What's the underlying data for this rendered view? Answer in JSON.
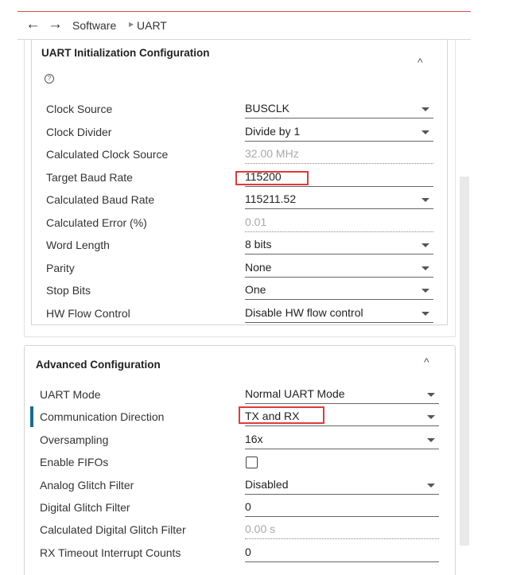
{
  "breadcrumb": {
    "back_icon": "arrow-left-icon",
    "forward_icon": "arrow-right-icon",
    "items": [
      "Software",
      "UART"
    ]
  },
  "init_config": {
    "title": "UART Initialization Configuration",
    "rows": [
      {
        "label": "Clock Source",
        "value": "BUSCLK",
        "type": "dropdown"
      },
      {
        "label": "Clock Divider",
        "value": "Divide by 1",
        "type": "dropdown"
      },
      {
        "label": "Calculated Clock Source",
        "value": "32.00 MHz",
        "type": "readonly"
      },
      {
        "label": "Target Baud Rate",
        "value": "115200",
        "type": "input"
      },
      {
        "label": "Calculated Baud Rate",
        "value": "115211.52",
        "type": "dropdown"
      },
      {
        "label": "Calculated Error (%)",
        "value": "0.01",
        "type": "readonly"
      },
      {
        "label": "Word Length",
        "value": "8 bits",
        "type": "dropdown"
      },
      {
        "label": "Parity",
        "value": "None",
        "type": "dropdown"
      },
      {
        "label": "Stop Bits",
        "value": "One",
        "type": "dropdown"
      },
      {
        "label": "HW Flow Control",
        "value": "Disable HW flow control",
        "type": "dropdown"
      }
    ]
  },
  "advanced_config": {
    "title": "Advanced Configuration",
    "rows": [
      {
        "label": "UART Mode",
        "value": "Normal UART Mode",
        "type": "dropdown"
      },
      {
        "label": "Communication Direction",
        "value": "TX and RX",
        "type": "dropdown"
      },
      {
        "label": "Oversampling",
        "value": "16x",
        "type": "dropdown"
      },
      {
        "label": "Enable FIFOs",
        "value": "",
        "type": "checkbox",
        "checked": false
      },
      {
        "label": "Analog Glitch Filter",
        "value": "Disabled",
        "type": "dropdown"
      },
      {
        "label": "Digital Glitch Filter",
        "value": "0",
        "type": "input"
      },
      {
        "label": "Calculated Digital Glitch Filter",
        "value": "0.00 s",
        "type": "readonly"
      },
      {
        "label": "RX Timeout Interrupt Counts",
        "value": "0",
        "type": "input"
      }
    ]
  },
  "colors": {
    "highlight": "#e03a3a",
    "focus_bar": "#1a6a8a",
    "accent_top": "#d9534f"
  }
}
